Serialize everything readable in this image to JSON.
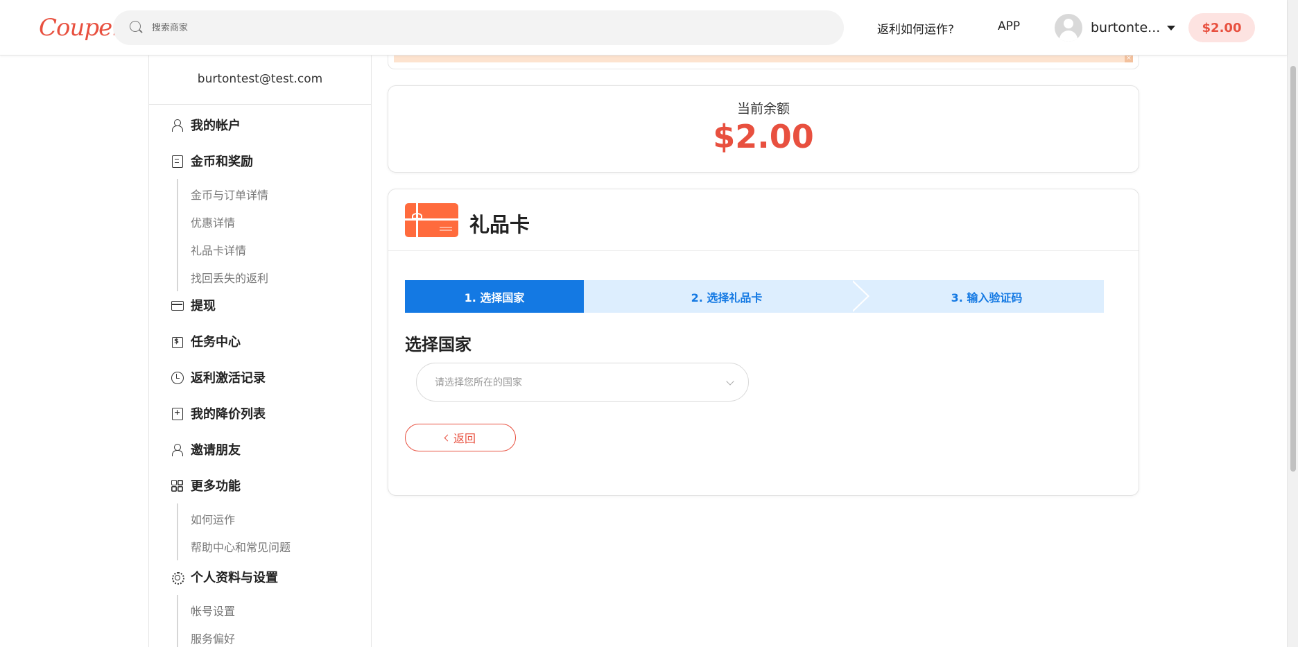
{
  "header": {
    "logo": "Coupert",
    "search_placeholder": "搜索商家",
    "nav_how": "返利如何运作?",
    "nav_app": "APP",
    "username": "burtonte...",
    "balance": "$2.00"
  },
  "sidebar": {
    "email": "burtontest@test.com",
    "items": [
      {
        "label": "我的帐户",
        "icon": "user-icon"
      },
      {
        "label": "金币和奖励",
        "icon": "document-icon"
      },
      {
        "label": "提现",
        "icon": "card-icon"
      },
      {
        "label": "任务中心",
        "icon": "task-icon"
      },
      {
        "label": "返利激活记录",
        "icon": "clock-icon"
      },
      {
        "label": "我的降价列表",
        "icon": "price-tag-icon"
      },
      {
        "label": "邀请朋友",
        "icon": "invite-user-icon"
      },
      {
        "label": "更多功能",
        "icon": "grid-icon"
      },
      {
        "label": "个人资料与设置",
        "icon": "gear-icon"
      }
    ],
    "rewards_sub": [
      "金币与订单详情",
      "优惠详情",
      "礼品卡详情",
      "找回丢失的返利"
    ],
    "more_sub": [
      "如何运作",
      "帮助中心和常见问题"
    ],
    "settings_sub": [
      "帐号设置",
      "服务偏好"
    ]
  },
  "balance_card": {
    "label": "当前余额",
    "amount": "$2.00"
  },
  "gift_card": {
    "title": "礼品卡",
    "steps": [
      "1. 选择国家",
      "2. 选择礼品卡",
      "3. 输入验证码"
    ],
    "section_title": "选择国家",
    "country_placeholder": "请选择您所在的国家",
    "back_label": "返回"
  },
  "colors": {
    "accent_red": "#e8503f",
    "step_active": "#1479e3",
    "step_inactive": "#ddeefe",
    "gift_icon": "#ff6b3d"
  }
}
